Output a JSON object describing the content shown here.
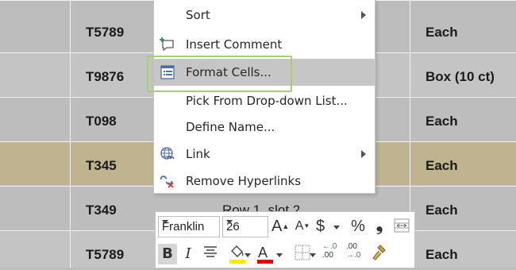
{
  "sheet": {
    "rows": [
      {
        "code": "T5789",
        "slot": "",
        "unit": "Each",
        "style": "even"
      },
      {
        "code": "T9876",
        "slot": "",
        "unit": "Box (10 ct)",
        "style": "odd"
      },
      {
        "code": "T098",
        "slot": "",
        "unit": "Each",
        "style": "even"
      },
      {
        "code": "T345",
        "slot": "",
        "unit": "Each",
        "style": "hl"
      },
      {
        "code": "T349",
        "slot": "Row 1, slot 2",
        "unit": "Each",
        "style": "even"
      },
      {
        "code": "T5789",
        "slot": "",
        "unit": "Each",
        "style": "odd"
      }
    ]
  },
  "context_menu": {
    "items": [
      {
        "label": "Sort",
        "icon": "",
        "submenu": true
      },
      {
        "label": "Insert Comment",
        "icon": "insert-comment-icon",
        "submenu": false
      },
      {
        "label": "Format Cells...",
        "icon": "format-cells-icon",
        "submenu": false,
        "active": true
      },
      {
        "label": "Pick From Drop-down List...",
        "icon": "",
        "submenu": false
      },
      {
        "label": "Define Name...",
        "icon": "",
        "submenu": false
      },
      {
        "label": "Link",
        "icon": "link-globe-icon",
        "submenu": true
      },
      {
        "label": "Remove Hyperlinks",
        "icon": "remove-hyperlink-icon",
        "submenu": false
      }
    ]
  },
  "mini_toolbar": {
    "font": "Franklin",
    "size": "26",
    "grow_font": "A",
    "shrink_font": "A",
    "currency": "$",
    "percent": "%",
    "comma": "❟",
    "bold": "B",
    "italic": "I",
    "font_color_letter": "A",
    "inc_decimal_top": "←.0",
    "inc_decimal_bottom": ".00",
    "dec_decimal_top": ".00",
    "dec_decimal_bottom": "→.0",
    "colors": {
      "highlight": "#ffeb00",
      "font_color": "#e00000"
    }
  }
}
